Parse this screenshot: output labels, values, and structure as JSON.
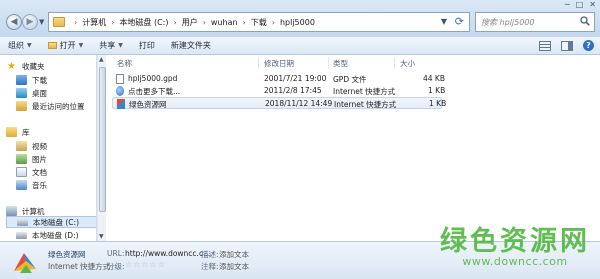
{
  "address_bar": {
    "breadcrumbs": [
      "计算机",
      "本地磁盘 (C:)",
      "用户",
      "wuhan",
      "下载",
      "hplj5000"
    ],
    "search_placeholder": "搜索 hplj5000"
  },
  "toolbar": {
    "organize": "组织",
    "open": "打开",
    "share": "共享",
    "print": "打印",
    "new_folder": "新建文件夹"
  },
  "navigation": {
    "favorites": "收藏夹",
    "downloads": "下载",
    "desktop": "桌面",
    "recent": "最近访问的位置",
    "libraries": "库",
    "videos": "视频",
    "pictures": "图片",
    "documents": "文档",
    "music": "音乐",
    "computer": "计算机",
    "drive_c": "本地磁盘 (C:)",
    "drive_d": "本地磁盘 (D:)"
  },
  "columns": {
    "name": "名称",
    "date": "修改日期",
    "type": "类型",
    "size": "大小"
  },
  "files": [
    {
      "name": "hplj5000.gpd",
      "date": "2001/7/21 19:00",
      "type": "GPD 文件",
      "size": "44 KB",
      "icon": "gpd-file-icon"
    },
    {
      "name": "点击更多下载...",
      "date": "2011/2/8 17:45",
      "type": "Internet 快捷方式",
      "size": "1 KB",
      "icon": "ie-shortcut-icon"
    },
    {
      "name": "绿色资源网",
      "date": "2018/11/12 14:49",
      "type": "Internet 快捷方式",
      "size": "1 KB",
      "icon": "site-logo-icon"
    }
  ],
  "details": {
    "name": "绿色资源网",
    "kind": "Internet 快捷方式",
    "url_label": "URL:",
    "url_value": "http://www.downcc.c...",
    "rating_label": "分级:",
    "rating_stars": "☆☆☆☆☆",
    "desc_label": "描述:",
    "desc_value": "添加文本",
    "notes_label": "注释:",
    "notes_value": "添加文本"
  },
  "watermark": {
    "text": "绿色资源网",
    "url": "www.downcc.com"
  },
  "colors": {
    "accent": "#55b944",
    "frame": "#cfe0f2",
    "selection": "#dce9f8"
  }
}
